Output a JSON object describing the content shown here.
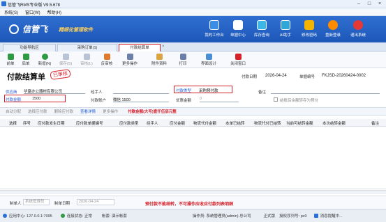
{
  "window": {
    "title": "信管飞RMS专业版 V9.5.678"
  },
  "menu": [
    "系统(S)",
    "窗口(W)",
    "帮助(H)"
  ],
  "banner": {
    "logo": "信管飞",
    "slogan": "精细化管理软件",
    "tools": [
      "我的工作台",
      "单据中心",
      "库存查询",
      "AI助手",
      "修改密码",
      "重新登录",
      "退出系统"
    ],
    "tool_colors": [
      "#3b8ee8",
      "#2f7bd9",
      "#3bb8e8",
      "#2ca7d8",
      "#f4b400",
      "#ff8c00",
      "#e53935"
    ]
  },
  "tabs": [
    "功能导航区",
    "采购订单(1)",
    "付款结算单"
  ],
  "toolbar": [
    "前单",
    "后单",
    "新增(N)",
    "保存(S)",
    "审核(L)",
    "反审核",
    "更多操作",
    "附件资料",
    "打印",
    "界面设计",
    "关闭窗口"
  ],
  "form": {
    "title": "付款结算单",
    "stamp": "已审核",
    "supplier_label": "供应商",
    "supplier_value": "华夏办公器材有限公司",
    "handler_label": "经手人",
    "pay_type_label": "付款类型",
    "pay_type_value": "采购预付款",
    "remark_label": "备注",
    "date_label": "付款日期",
    "date_value": "2026-04-24",
    "doc_no_label": "单据编号",
    "doc_no_value": "FKJSD-20260424-0002",
    "amount_label": "付款金额",
    "amount_value": "1500",
    "account_label": "付款账户",
    "account_value": "微信 1500",
    "discount_label": "优惠金额",
    "discount_value": "0",
    "checkbox_label": "结账后余额转存为预付"
  },
  "subbar": {
    "items": [
      "自动分配",
      "选择应付款",
      "删除应付款",
      "查看详情",
      "更多操作"
    ],
    "amount_text": "付款金额(大写)壹仟伍佰元整"
  },
  "table": {
    "headers": [
      "选择",
      "序号",
      "应付款发生日期",
      "应付款单据编号",
      "应付款类型",
      "经手人",
      "应付金额",
      "物流代付金额",
      "本单已结转",
      "物流代付已结转",
      "当前可结转金额",
      "本次结转金额",
      "备注"
    ]
  },
  "footer": {
    "maker_label": "制单人",
    "maker_value": "系统管理员",
    "make_date_label": "制单日期",
    "make_date_value": "2026-04-24",
    "note": "预付款不能结转，不可操作应收应付款列表明细"
  },
  "status": {
    "server": "应用中心: 127.0.0.1:7095",
    "conn": "连接状态: 正常",
    "account": "帐套: 演示帐套",
    "operator": "操作员: 系统管理员(admin) 总公司",
    "edition": "正式版",
    "serial": "授权序列号: pc0",
    "msg": "消息提醒中..."
  }
}
